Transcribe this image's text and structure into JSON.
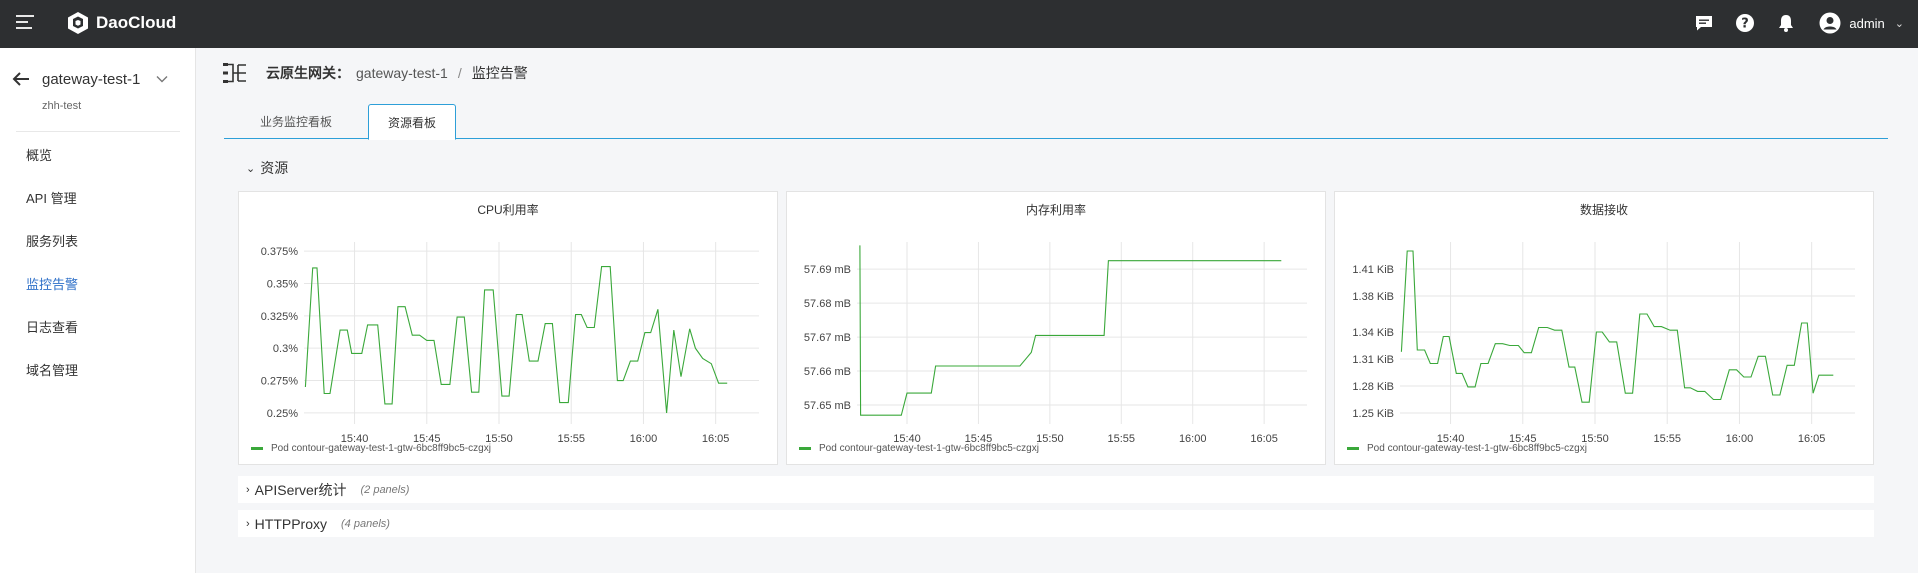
{
  "topbar": {
    "brand": "DaoCloud",
    "user": "admin",
    "icons": [
      "menu-icon",
      "message-icon",
      "help-icon",
      "bell-icon",
      "user-avatar-icon",
      "chevron-down-icon"
    ]
  },
  "sidebar": {
    "gateway_name": "gateway-test-1",
    "gateway_sub": "zhh-test",
    "items": [
      {
        "label": "概览",
        "active": false
      },
      {
        "label": "API 管理",
        "active": false
      },
      {
        "label": "服务列表",
        "active": false
      },
      {
        "label": "监控告警",
        "active": true
      },
      {
        "label": "日志查看",
        "active": false
      },
      {
        "label": "域名管理",
        "active": false
      }
    ]
  },
  "breadcrumb": {
    "root": "云原生网关：",
    "gateway": "gateway-test-1",
    "separator": "/",
    "current": "监控告警"
  },
  "tabs": [
    {
      "label": "业务监控看板",
      "active": false
    },
    {
      "label": "资源看板",
      "active": true
    }
  ],
  "sections": {
    "resources": {
      "label": "资源"
    },
    "apiserver": {
      "label": "APIServer统计",
      "hint": "(2 panels)"
    },
    "httpproxy": {
      "label": "HTTPProxy",
      "hint": "(4 panels)"
    }
  },
  "colors": {
    "series": "#3aa83a",
    "accent": "#2d9fd8",
    "active_nav": "#2d6fc8",
    "topbar": "#2d2f31"
  },
  "chart_data": [
    {
      "type": "line",
      "title": "CPU利用率",
      "xlabel": "",
      "ylabel": "",
      "x_ticks": [
        "15:40",
        "15:45",
        "15:50",
        "15:55",
        "16:00",
        "16:05"
      ],
      "x_tick_minutes": [
        0,
        5,
        10,
        15,
        20,
        25
      ],
      "xlim": [
        -3.5,
        28
      ],
      "y_ticks": [
        "0.375%",
        "0.35%",
        "0.325%",
        "0.3%",
        "0.275%",
        "0.25%"
      ],
      "y_tick_values": [
        0.375,
        0.35,
        0.325,
        0.3,
        0.275,
        0.25
      ],
      "ylim": [
        0.243,
        0.382
      ],
      "step": false,
      "legend": "bottom-left",
      "series": [
        {
          "name": "Pod contour-gateway-test-1-gtw-6bc8ff9bc5-czgxj",
          "x": [
            -3.4,
            -2.9,
            -2.6,
            -2.1,
            -1.7,
            -1.0,
            -0.5,
            -0.2,
            0.5,
            0.9,
            1.6,
            2.1,
            2.6,
            3.0,
            3.5,
            4.0,
            4.5,
            5.0,
            5.5,
            6.0,
            6.6,
            7.1,
            7.6,
            8.1,
            8.6,
            9.0,
            9.6,
            10.2,
            10.7,
            11.2,
            11.6,
            12.1,
            12.7,
            13.2,
            13.7,
            14.2,
            14.8,
            15.3,
            15.7,
            16.1,
            16.6,
            17.1,
            17.7,
            18.2,
            18.6,
            19.1,
            19.6,
            20.1,
            20.5,
            21.0,
            21.6,
            22.1,
            22.6,
            23.2,
            23.6,
            24.1,
            24.7,
            25.2,
            25.8
          ],
          "y": [
            0.27,
            0.362,
            0.362,
            0.265,
            0.265,
            0.314,
            0.314,
            0.296,
            0.296,
            0.318,
            0.318,
            0.257,
            0.257,
            0.332,
            0.332,
            0.31,
            0.31,
            0.306,
            0.306,
            0.272,
            0.272,
            0.324,
            0.324,
            0.266,
            0.266,
            0.345,
            0.345,
            0.263,
            0.263,
            0.326,
            0.326,
            0.29,
            0.29,
            0.319,
            0.319,
            0.258,
            0.258,
            0.326,
            0.326,
            0.316,
            0.316,
            0.363,
            0.363,
            0.275,
            0.275,
            0.29,
            0.29,
            0.312,
            0.312,
            0.33,
            0.25,
            0.314,
            0.278,
            0.315,
            0.3,
            0.292,
            0.288,
            0.273,
            0.273
          ]
        }
      ]
    },
    {
      "type": "line",
      "title": "内存利用率",
      "xlabel": "",
      "ylabel": "",
      "x_ticks": [
        "15:40",
        "15:45",
        "15:50",
        "15:55",
        "16:00",
        "16:05"
      ],
      "x_tick_minutes": [
        0,
        5,
        10,
        15,
        20,
        25
      ],
      "xlim": [
        -3.5,
        28
      ],
      "y_ticks": [
        "57.69 mB",
        "57.68 mB",
        "57.67 mB",
        "57.66 mB",
        "57.65 mB"
      ],
      "y_tick_values": [
        57.69,
        57.68,
        57.67,
        57.66,
        57.65
      ],
      "ylim": [
        57.645,
        57.698
      ],
      "step": true,
      "legend": "bottom-left",
      "series": [
        {
          "name": "Pod contour-gateway-test-1-gtw-6bc8ff9bc5-czgxj",
          "x": [
            -3.3,
            -3.25,
            -0.4,
            0.0,
            1.7,
            2.0,
            7.9,
            8.3,
            8.7,
            9.0,
            13.8,
            14.1,
            26.2
          ],
          "y": [
            57.697,
            57.647,
            57.647,
            57.6535,
            57.6535,
            57.6615,
            57.6615,
            57.6635,
            57.6655,
            57.6705,
            57.6705,
            57.6925,
            57.6925
          ]
        }
      ]
    },
    {
      "type": "line",
      "title": "数据接收",
      "xlabel": "",
      "ylabel": "",
      "x_ticks": [
        "15:40",
        "15:45",
        "15:50",
        "15:55",
        "16:00",
        "16:05"
      ],
      "x_tick_minutes": [
        0,
        5,
        10,
        15,
        20,
        25
      ],
      "xlim": [
        -3.5,
        28
      ],
      "y_ticks": [
        "1.41 KiB",
        "1.38 KiB",
        "1.34 KiB",
        "1.31 KiB",
        "1.28 KiB",
        "1.25 KiB"
      ],
      "y_tick_values": [
        1.41,
        1.38,
        1.34,
        1.31,
        1.28,
        1.25
      ],
      "ylim": [
        1.24,
        1.44
      ],
      "step": false,
      "legend": "bottom-left",
      "series": [
        {
          "name": "Pod contour-gateway-test-1-gtw-6bc8ff9bc5-czgxj",
          "x": [
            -3.4,
            -3.0,
            -2.6,
            -2.3,
            -1.8,
            -1.4,
            -0.9,
            -0.5,
            -0.1,
            0.4,
            0.8,
            1.2,
            1.7,
            2.1,
            2.6,
            3.1,
            3.6,
            4.1,
            4.7,
            5.1,
            5.6,
            6.1,
            6.7,
            7.2,
            7.7,
            8.2,
            8.6,
            9.1,
            9.6,
            10.1,
            10.5,
            11.0,
            11.5,
            12.1,
            12.6,
            13.1,
            13.6,
            14.1,
            14.6,
            15.2,
            15.7,
            16.2,
            16.6,
            17.1,
            17.6,
            18.2,
            18.7,
            19.3,
            19.8,
            20.3,
            20.8,
            21.3,
            21.8,
            22.3,
            22.8,
            23.3,
            23.8,
            24.3,
            24.7,
            25.1,
            25.5,
            26.0,
            26.5
          ],
          "y": [
            1.318,
            1.43,
            1.43,
            1.32,
            1.32,
            1.305,
            1.305,
            1.335,
            1.335,
            1.294,
            1.294,
            1.279,
            1.279,
            1.305,
            1.305,
            1.327,
            1.327,
            1.325,
            1.325,
            1.317,
            1.317,
            1.345,
            1.345,
            1.342,
            1.342,
            1.301,
            1.301,
            1.262,
            1.262,
            1.34,
            1.34,
            1.329,
            1.329,
            1.272,
            1.272,
            1.36,
            1.36,
            1.346,
            1.346,
            1.342,
            1.342,
            1.278,
            1.278,
            1.274,
            1.274,
            1.265,
            1.265,
            1.298,
            1.298,
            1.29,
            1.29,
            1.313,
            1.313,
            1.27,
            1.27,
            1.303,
            1.303,
            1.35,
            1.35,
            1.272,
            1.292,
            1.292,
            1.292
          ]
        }
      ]
    }
  ]
}
